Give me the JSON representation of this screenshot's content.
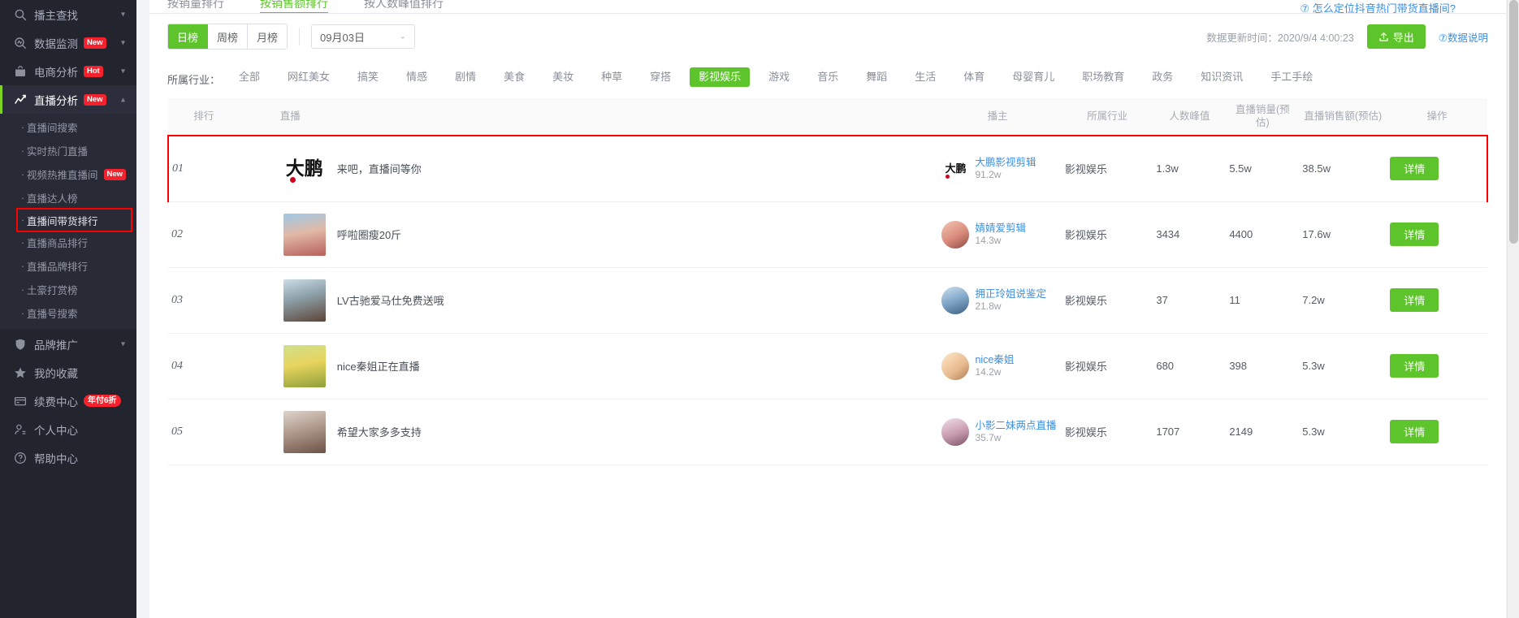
{
  "sidebar": {
    "groups": [
      {
        "icon": "search-icon",
        "label": "播主查找",
        "badge": null,
        "chevron": "▾",
        "active": false
      },
      {
        "icon": "monitor-icon",
        "label": "数据监测",
        "badge": "New",
        "chevron": "▾",
        "active": false
      },
      {
        "icon": "briefcase-icon",
        "label": "电商分析",
        "badge": "Hot",
        "chevron": "▾",
        "active": false
      },
      {
        "icon": "chart-line-icon",
        "label": "直播分析",
        "badge": "New",
        "chevron": "▴",
        "active": true
      }
    ],
    "submenu": [
      {
        "label": "直播间搜索",
        "badge": null,
        "highlighted": false
      },
      {
        "label": "实时热门直播",
        "badge": null,
        "highlighted": false
      },
      {
        "label": "视频热推直播间",
        "badge": "New",
        "highlighted": false
      },
      {
        "label": "直播达人榜",
        "badge": null,
        "highlighted": false
      },
      {
        "label": "直播间带货排行",
        "badge": null,
        "highlighted": true
      },
      {
        "label": "直播商品排行",
        "badge": null,
        "highlighted": false
      },
      {
        "label": "直播品牌排行",
        "badge": null,
        "highlighted": false
      },
      {
        "label": "土豪打赏榜",
        "badge": null,
        "highlighted": false
      },
      {
        "label": "直播号搜索",
        "badge": null,
        "highlighted": false
      }
    ],
    "bottom": [
      {
        "icon": "shield-icon",
        "label": "品牌推广",
        "badge": null,
        "chevron": "▾"
      },
      {
        "icon": "star-icon",
        "label": "我的收藏",
        "badge": null,
        "chevron": null
      },
      {
        "icon": "card-icon",
        "label": "续费中心",
        "badge": "年付6折",
        "chevron": null
      },
      {
        "icon": "user-icon",
        "label": "个人中心",
        "badge": null,
        "chevron": null
      },
      {
        "icon": "question-icon",
        "label": "帮助中心",
        "badge": null,
        "chevron": null
      }
    ]
  },
  "top_tabs": {
    "items": [
      {
        "label": "按销量排行",
        "selected": false
      },
      {
        "label": "按销售额排行",
        "selected": true
      },
      {
        "label": "按人数峰值排行",
        "selected": false
      }
    ],
    "help_link": "⑦ 怎么定位抖音热门带货直播间?"
  },
  "toolbar": {
    "range_buttons": [
      {
        "label": "日榜",
        "selected": true
      },
      {
        "label": "周榜",
        "selected": false
      },
      {
        "label": "月榜",
        "selected": false
      }
    ],
    "date_value": "09月03日",
    "date_caret": "⌄",
    "update_time": "数据更新时间：2020/9/4 4:00:23",
    "export_label": "导出",
    "data_note": "⑦数据说明"
  },
  "filter": {
    "label": "所属行业：",
    "tags": [
      {
        "label": "全部",
        "selected": false
      },
      {
        "label": "网红美女",
        "selected": false
      },
      {
        "label": "搞笑",
        "selected": false
      },
      {
        "label": "情感",
        "selected": false
      },
      {
        "label": "剧情",
        "selected": false
      },
      {
        "label": "美食",
        "selected": false
      },
      {
        "label": "美妆",
        "selected": false
      },
      {
        "label": "种草",
        "selected": false
      },
      {
        "label": "穿搭",
        "selected": false
      },
      {
        "label": "影视娱乐",
        "selected": true
      },
      {
        "label": "游戏",
        "selected": false
      },
      {
        "label": "音乐",
        "selected": false
      },
      {
        "label": "舞蹈",
        "selected": false
      },
      {
        "label": "生活",
        "selected": false
      },
      {
        "label": "体育",
        "selected": false
      },
      {
        "label": "母婴育儿",
        "selected": false
      },
      {
        "label": "职场教育",
        "selected": false
      },
      {
        "label": "政务",
        "selected": false
      },
      {
        "label": "知识资讯",
        "selected": false
      },
      {
        "label": "手工手绘",
        "selected": false
      }
    ]
  },
  "table": {
    "headers": {
      "rank": "排行",
      "live": "直播",
      "host": "播主",
      "industry": "所属行业",
      "peak": "人数峰值",
      "sales": "直播销量(预估)",
      "gmv": "直播销售额(预估)",
      "action": "操作"
    },
    "action_label": "详情",
    "rows": [
      {
        "rank": "01",
        "live_title": "来吧，直播间等你",
        "host_name": "大鹏影视剪辑",
        "host_fans": "91.2w",
        "industry": "影视娱乐",
        "peak": "1.3w",
        "sales": "5.5w",
        "gmv": "38.5w",
        "highlighted": true
      },
      {
        "rank": "02",
        "live_title": "呼啦圈瘦20斤",
        "host_name": "婧婧爱剪辑",
        "host_fans": "14.3w",
        "industry": "影视娱乐",
        "peak": "3434",
        "sales": "4400",
        "gmv": "17.6w",
        "highlighted": false
      },
      {
        "rank": "03",
        "live_title": "LV古驰爱马仕免费送哦",
        "host_name": "拥正玲姐说鉴定",
        "host_fans": "21.8w",
        "industry": "影视娱乐",
        "peak": "37",
        "sales": "11",
        "gmv": "7.2w",
        "highlighted": false
      },
      {
        "rank": "04",
        "live_title": "nice秦姐正在直播",
        "host_name": "nice秦姐",
        "host_fans": "14.2w",
        "industry": "影视娱乐",
        "peak": "680",
        "sales": "398",
        "gmv": "5.3w",
        "highlighted": false
      },
      {
        "rank": "05",
        "live_title": "希望大家多多支持",
        "host_name": "小影二妹两点直播",
        "host_fans": "35.7w",
        "industry": "影视娱乐",
        "peak": "1707",
        "sales": "2149",
        "gmv": "5.3w",
        "highlighted": false
      }
    ]
  }
}
